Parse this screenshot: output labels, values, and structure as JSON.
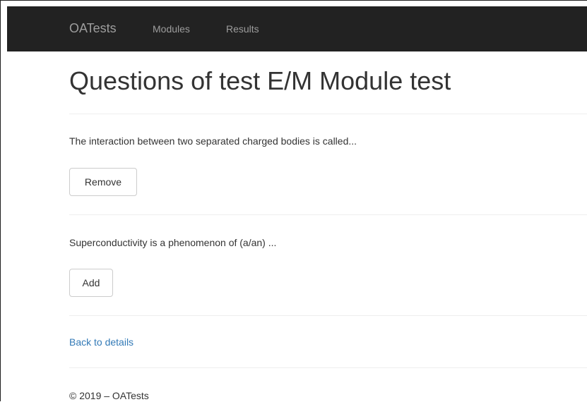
{
  "navbar": {
    "brand": "OATests",
    "links": [
      "Modules",
      "Results"
    ]
  },
  "page": {
    "title": "Questions of test E/M Module test"
  },
  "questions": [
    {
      "text": "The interaction between two separated charged bodies is called...",
      "action": "Remove"
    },
    {
      "text": "Superconductivity is a phenomenon of (a/an) ...",
      "action": "Add"
    }
  ],
  "back_link": "Back to details",
  "footer": "© 2019 – OATests",
  "colors": {
    "navbar_bg": "#222222",
    "nav_text": "#9d9d9d",
    "link": "#337ab7",
    "divider": "#eeeeee"
  }
}
